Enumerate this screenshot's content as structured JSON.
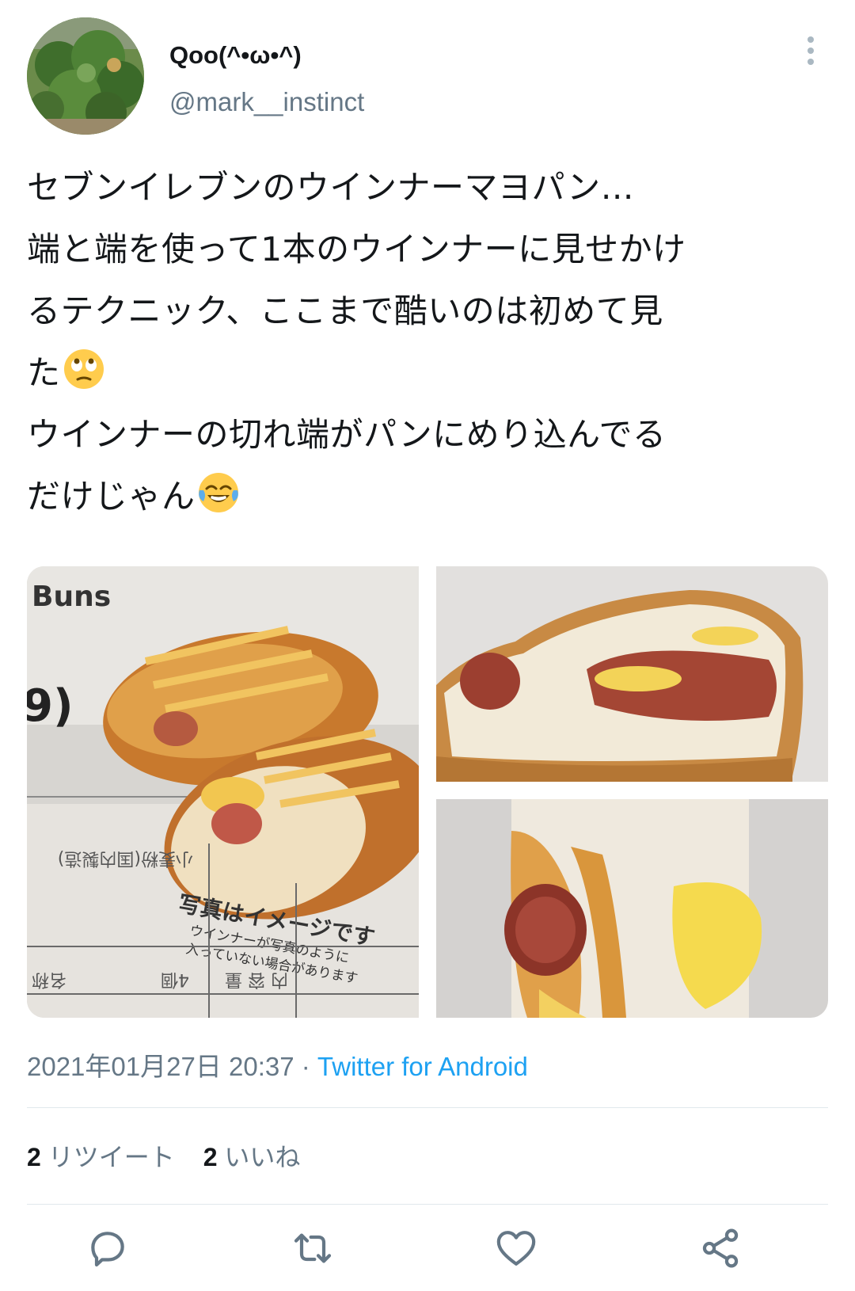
{
  "user": {
    "display_name": "Qoo(^•ω•^)",
    "handle": "@mark__instinct"
  },
  "tweet": {
    "lines": [
      "セブンイレブンのウインナーマヨパン…",
      "端と端を使って1本のウインナーに見せかけ",
      "るテクニック、ここまで酷いのは初めて見",
      "た",
      "ウインナーの切れ端がパンにめり込んでる",
      "だけじゃん"
    ],
    "emojis": [
      "face-with-rolling-eyes",
      "face-with-tears-of-joy"
    ]
  },
  "media": {
    "package_photo": {
      "buns_label": "Buns",
      "digit_label": "9)",
      "disclaimer_title": "写真はイメージです",
      "disclaimer_line1": "ウインナーが写真のように",
      "disclaimer_line2": "入っていない場合があります",
      "cut_text_1": "小麦粉(国内製造)",
      "cut_text_2": "内 容 量",
      "cut_text_3": "4個",
      "cut_text_4": "名称"
    }
  },
  "meta": {
    "timestamp": "2021年01月27日 20:37",
    "separator": " · ",
    "source": "Twitter for Android"
  },
  "stats": {
    "retweets_count": "2",
    "retweets_label": "リツイート",
    "likes_count": "2",
    "likes_label": "いいね"
  },
  "icons": [
    "reply-icon",
    "retweet-icon",
    "like-icon",
    "share-icon",
    "more-icon"
  ],
  "colors": {
    "accent": "#1da1f2",
    "secondary_text": "#657786",
    "icon_gray": "#657786",
    "divider": "#e1e8ed"
  }
}
